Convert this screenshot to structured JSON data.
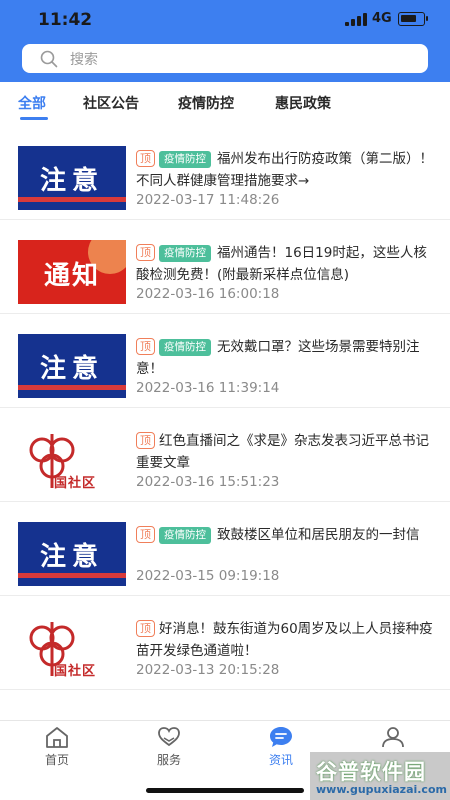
{
  "status_bar": {
    "time": "11:42",
    "network": "4G",
    "battery_icon": "battery-icon",
    "signal_icon": "signal-icon"
  },
  "search": {
    "placeholder": "搜索",
    "icon": "search-icon"
  },
  "tabs": [
    {
      "label": "全部",
      "active": true
    },
    {
      "label": "社区公告",
      "active": false
    },
    {
      "label": "疫情防控",
      "active": false
    },
    {
      "label": "惠民政策",
      "active": false
    }
  ],
  "news": [
    {
      "thumb_label": "注意",
      "thumb_style": "notice",
      "pin": "顶",
      "tag": "疫情防控",
      "title": "福州发布出行防疫政策（第二版）！不同人群健康管理措施要求→",
      "date": "2022-03-17 11:48:26"
    },
    {
      "thumb_label": "通知",
      "thumb_style": "announce",
      "pin": "顶",
      "tag": "疫情防控",
      "title": "福州通告！16日19时起，这些人核酸检测免费！(附最新采样点位信息)",
      "date": "2022-03-16 16:00:18"
    },
    {
      "thumb_label": "注意",
      "thumb_style": "notice",
      "pin": "顶",
      "tag": "疫情防控",
      "title": "无效戴口罩？这些场景需要特别注意！",
      "date": "2022-03-16 11:39:14"
    },
    {
      "thumb_label": "国社区",
      "thumb_style": "community",
      "pin": "顶",
      "tag": "",
      "title": "红色直播间之《求是》杂志发表习近平总书记重要文章",
      "date": "2022-03-16 15:51:23"
    },
    {
      "thumb_label": "注意",
      "thumb_style": "notice",
      "pin": "顶",
      "tag": "疫情防控",
      "title": "致鼓楼区单位和居民朋友的一封信",
      "date": "2022-03-15 09:19:18"
    },
    {
      "thumb_label": "国社区",
      "thumb_style": "community",
      "pin": "顶",
      "tag": "",
      "title": "好消息！鼓东街道为60周岁及以上人员接种疫苗开发绿色通道啦！",
      "date": "2022-03-13 20:15:28"
    }
  ],
  "bottom_nav": [
    {
      "label": "首页",
      "icon": "home-icon",
      "active": false
    },
    {
      "label": "服务",
      "icon": "heart-hand-icon",
      "active": false
    },
    {
      "label": "资讯",
      "icon": "chat-bubble-icon",
      "active": true
    },
    {
      "label": "我的",
      "icon": "user-icon",
      "active": false
    }
  ],
  "watermark": {
    "main": "谷普软件园",
    "url": "www.gupuxiazai.com"
  },
  "colors": {
    "primary": "#3d7ff0",
    "tag": "#4dbf9b",
    "pin": "#f07f5a",
    "notice_bg": "#15328f",
    "announce_bg": "#d8241c"
  }
}
